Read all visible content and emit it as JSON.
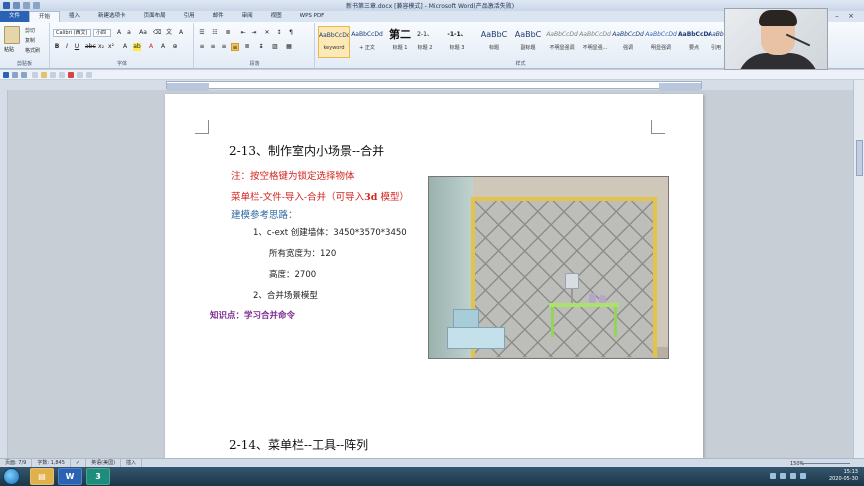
{
  "window": {
    "title": "新书第三章.docx [兼容模式] - Microsoft Word(产品激活失败)"
  },
  "tabs": [
    {
      "label": "文件"
    },
    {
      "label": "开始"
    },
    {
      "label": "插入"
    },
    {
      "label": "新建选项卡"
    },
    {
      "label": "页面布局"
    },
    {
      "label": "引用"
    },
    {
      "label": "邮件"
    },
    {
      "label": "审阅"
    },
    {
      "label": "视图"
    },
    {
      "label": "WPS PDF"
    }
  ],
  "ribbon": {
    "clipboard": {
      "paste": "粘贴",
      "cut": "剪切",
      "copy": "复制",
      "format_painter": "格式刷",
      "group": "剪贴板"
    },
    "font": {
      "name": "Calibri (西文)",
      "size": "小四",
      "group": "字体"
    },
    "paragraph": {
      "group": "段落"
    },
    "styles": {
      "group": "样式",
      "items": [
        {
          "sample": "AaBbCcDd",
          "name": "keyword"
        },
        {
          "sample": "AaBbCcDd",
          "name": "+ 正文"
        },
        {
          "sample": "第二",
          "name": "标题 1"
        },
        {
          "sample": "2-1、",
          "name": "标题 2"
        },
        {
          "sample": "-1-1、",
          "name": "标题 3"
        },
        {
          "sample": "AaBbC",
          "name": "标题"
        },
        {
          "sample": "AaBbC",
          "name": "副标题"
        },
        {
          "sample": "AaBbCcDd",
          "name": "不明显强调"
        },
        {
          "sample": "AaBbCcDd",
          "name": "不明显强..."
        },
        {
          "sample": "AaBbCcDd",
          "name": "强调"
        },
        {
          "sample": "AaBbCcDd",
          "name": "明显强调"
        },
        {
          "sample": "AaBbCcDd",
          "name": "要点"
        },
        {
          "sample": "AaBbCc",
          "name": "引用"
        }
      ]
    }
  },
  "document": {
    "heading1": "2-13、制作室内小场景--合并",
    "note": "注：按空格键为锁定选择物体",
    "menu_path_prefix": "菜单栏-文件-导入-合并（可导入",
    "menu_path_bold": "3d",
    "menu_path_suffix": "模型）",
    "thoughts": "建模参考思路：",
    "step1": "1、c-ext 创建墙体：3450*3570*3450",
    "width_line": "所有宽度为：120",
    "height_line": "高度：2700",
    "step2": "2、合并场景模型",
    "knowledge": "知识点：学习合并命令",
    "heading2": "2-14、菜单栏--工具--阵列"
  },
  "status": {
    "page": "页面: 7/9",
    "words": "字数: 1,845",
    "lang": "英语(美国)",
    "mode": "插入",
    "zoom": "150%"
  },
  "taskbar": {
    "word_button": "W",
    "app3_button": "3",
    "time": "15:13",
    "date": "2020-05-30"
  },
  "colors": {
    "accent": "#2a63b4",
    "note_red": "#d4241f",
    "thoughts_blue": "#2f6aa3",
    "knowledge_purple": "#7a2a8f"
  }
}
